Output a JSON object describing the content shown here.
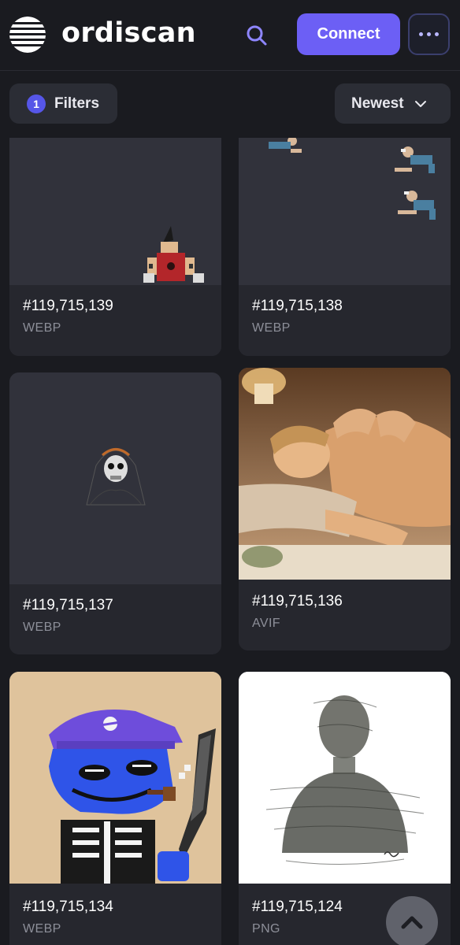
{
  "header": {
    "logo_text": "ordiscan",
    "connect_label": "Connect"
  },
  "toolbar": {
    "filter_count": "1",
    "filters_label": "Filters",
    "sort_label": "Newest"
  },
  "cards": [
    {
      "id": "#119,715,139",
      "type": "WEBP"
    },
    {
      "id": "#119,715,138",
      "type": "WEBP"
    },
    {
      "id": "#119,715,137",
      "type": "WEBP"
    },
    {
      "id": "#119,715,136",
      "type": "AVIF"
    },
    {
      "id": "#119,715,134",
      "type": "WEBP"
    },
    {
      "id": "#119,715,124",
      "type": "PNG"
    }
  ],
  "colors": {
    "background": "#1a1b20",
    "accent": "#6c5ff5",
    "card": "#2a2c33"
  },
  "icons": [
    "ordiscan-logo-icon",
    "search-icon",
    "more-dots-icon",
    "chevron-down-icon",
    "chevron-up-icon"
  ]
}
